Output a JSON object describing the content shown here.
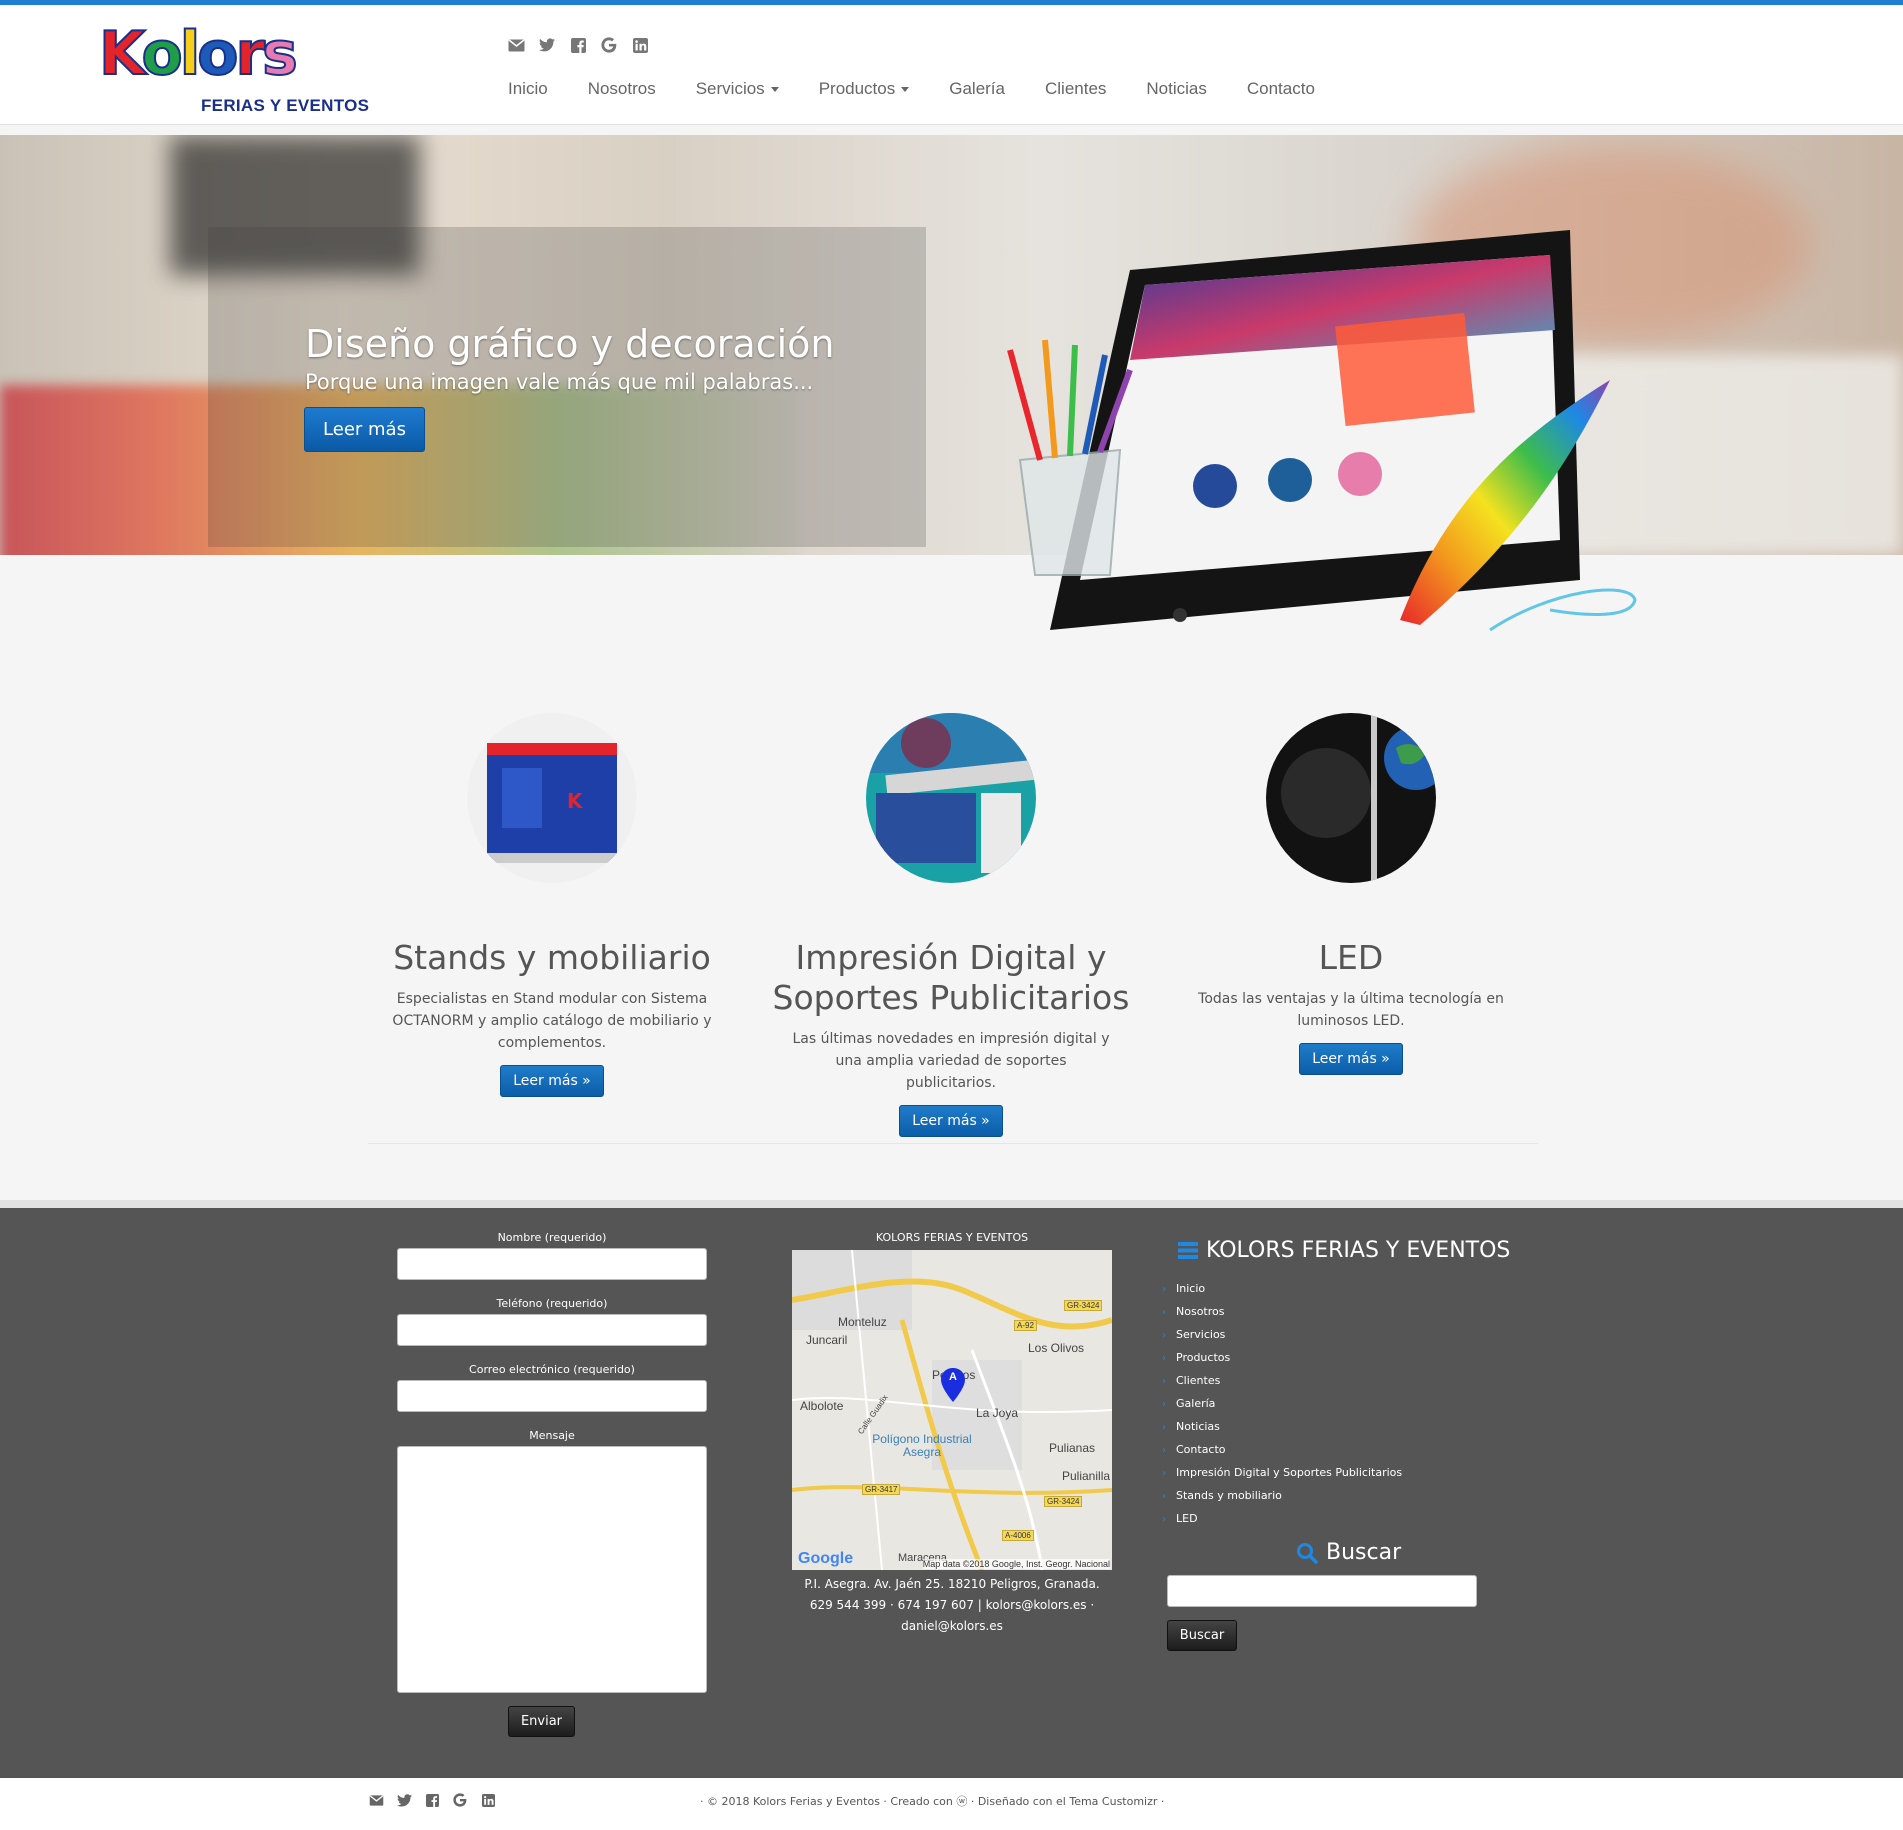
{
  "brand": {
    "logo_letters": [
      "K",
      "o",
      "l",
      "o",
      "r",
      "s"
    ],
    "logo_colors": [
      "#e3242b",
      "#1f9e49",
      "#f5cf19",
      "#1e5bb8",
      "#e3242b",
      "#e77bb0"
    ],
    "tagline": "FERIAS Y EVENTOS",
    "accent": "#1e7fd0"
  },
  "social_icons": [
    "email-icon",
    "twitter-icon",
    "facebook-icon",
    "google-icon",
    "linkedin-icon"
  ],
  "nav": {
    "items": [
      {
        "label": "Inicio",
        "dropdown": false
      },
      {
        "label": "Nosotros",
        "dropdown": false
      },
      {
        "label": "Servicios",
        "dropdown": true
      },
      {
        "label": "Productos",
        "dropdown": true
      },
      {
        "label": "Galería",
        "dropdown": false
      },
      {
        "label": "Clientes",
        "dropdown": false
      },
      {
        "label": "Noticias",
        "dropdown": false
      },
      {
        "label": "Contacto",
        "dropdown": false
      }
    ]
  },
  "hero": {
    "title": "Diseño gráfico y decoración",
    "subtitle": "Porque una imagen vale más que mil palabras...",
    "button": "Leer más"
  },
  "features": [
    {
      "title": "Stands y mobiliario",
      "text": "Especialistas en Stand modular con Sistema OCTANORM y amplio catálogo de mobiliario y complementos.",
      "button": "Leer más »"
    },
    {
      "title": "Impresión Digital y Soportes Publicitarios",
      "text": "Las últimas novedades en impresión digital y una amplia variedad de soportes publicitarios.",
      "button": "Leer más »"
    },
    {
      "title": "LED",
      "text": "Todas las ventajas y la última tecnología en luminosos LED.",
      "button": "Leer más »"
    }
  ],
  "contact_form": {
    "name_label": "Nombre (requerido)",
    "phone_label": "Teléfono (requerido)",
    "email_label": "Correo electrónico (requerido)",
    "message_label": "Mensaje",
    "submit": "Enviar"
  },
  "map": {
    "title": "KOLORS FERIAS Y EVENTOS",
    "places": [
      "Monteluz",
      "Juncaril",
      "Los Olivos",
      "Peligros",
      "Albolote",
      "La Joya",
      "Polígono Industrial Asegra",
      "Pulianas",
      "Pulianilla",
      "Calle Guadix",
      "Maracena"
    ],
    "roads": [
      "GR-3424",
      "A-92",
      "GR-3417",
      "GR-3424",
      "A-4006"
    ],
    "marker": "A",
    "google": "Google",
    "copyright": "Map data ©2018 Google, Inst. Geogr. Nacional",
    "address_line1": "P.I. Asegra. Av. Jaén 25. 18210 Peligros, Granada.",
    "address_line2": "629 544 399 · 674 197 607 | kolors@kolors.es ·",
    "address_line3": "daniel@kolors.es"
  },
  "sidebar": {
    "title": "KOLORS FERIAS Y EVENTOS",
    "links": [
      "Inicio",
      "Nosotros",
      "Servicios",
      "Productos",
      "Clientes",
      "Galería",
      "Noticias",
      "Contacto",
      "Impresión Digital y Soportes Publicitarios",
      "Stands y mobiliario",
      "LED"
    ],
    "search_title": "Buscar",
    "search_button": "Buscar"
  },
  "bottom": {
    "copyright": "· © 2018 Kolors Ferias y Eventos · Creado con ⓦ · Diseñado con el Tema Customizr ·"
  }
}
